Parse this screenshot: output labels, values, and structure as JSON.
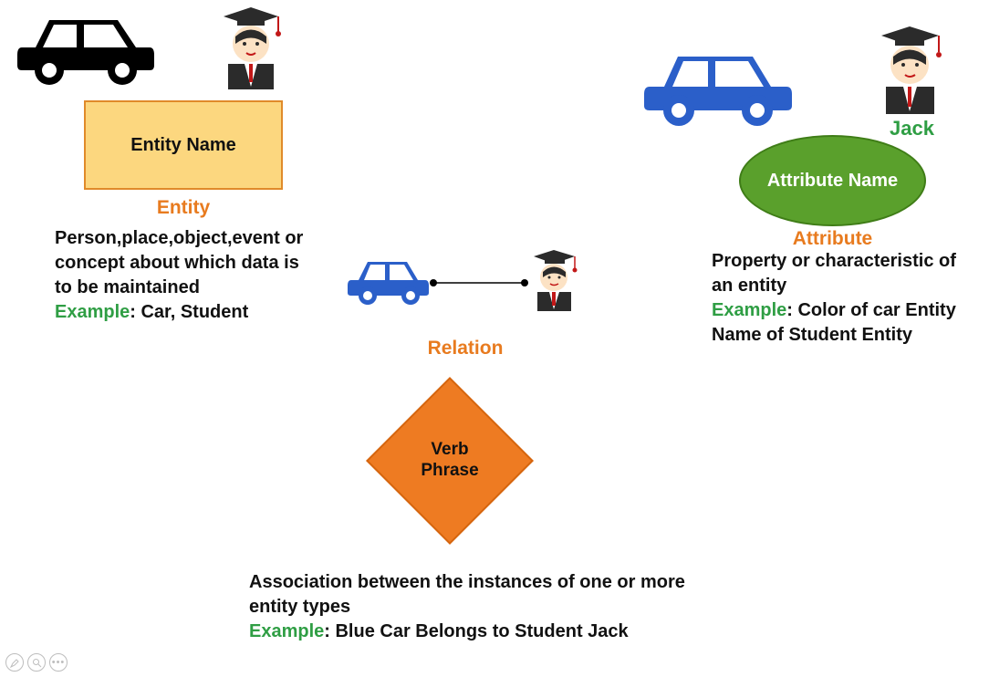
{
  "entity": {
    "box_label": "Entity Name",
    "title": "Entity",
    "description": "Person,place,object,event or concept about which data is to be maintained",
    "example_label": "Example",
    "example_text": ": Car, Student"
  },
  "relation": {
    "title": "Relation",
    "diamond_label": "Verb Phrase",
    "description": "Association between the instances of one or more entity types",
    "example_label": "Example",
    "example_text": ": Blue Car Belongs to Student Jack"
  },
  "attribute": {
    "jack_label": "Jack",
    "ellipse_label": "Attribute Name",
    "title": "Attribute",
    "description": "Property or characteristic of an entity",
    "example_label": "Example",
    "example_text": ": Color of car Entity Name of Student Entity"
  },
  "icons": {
    "car": "car-icon",
    "student": "student-icon"
  }
}
